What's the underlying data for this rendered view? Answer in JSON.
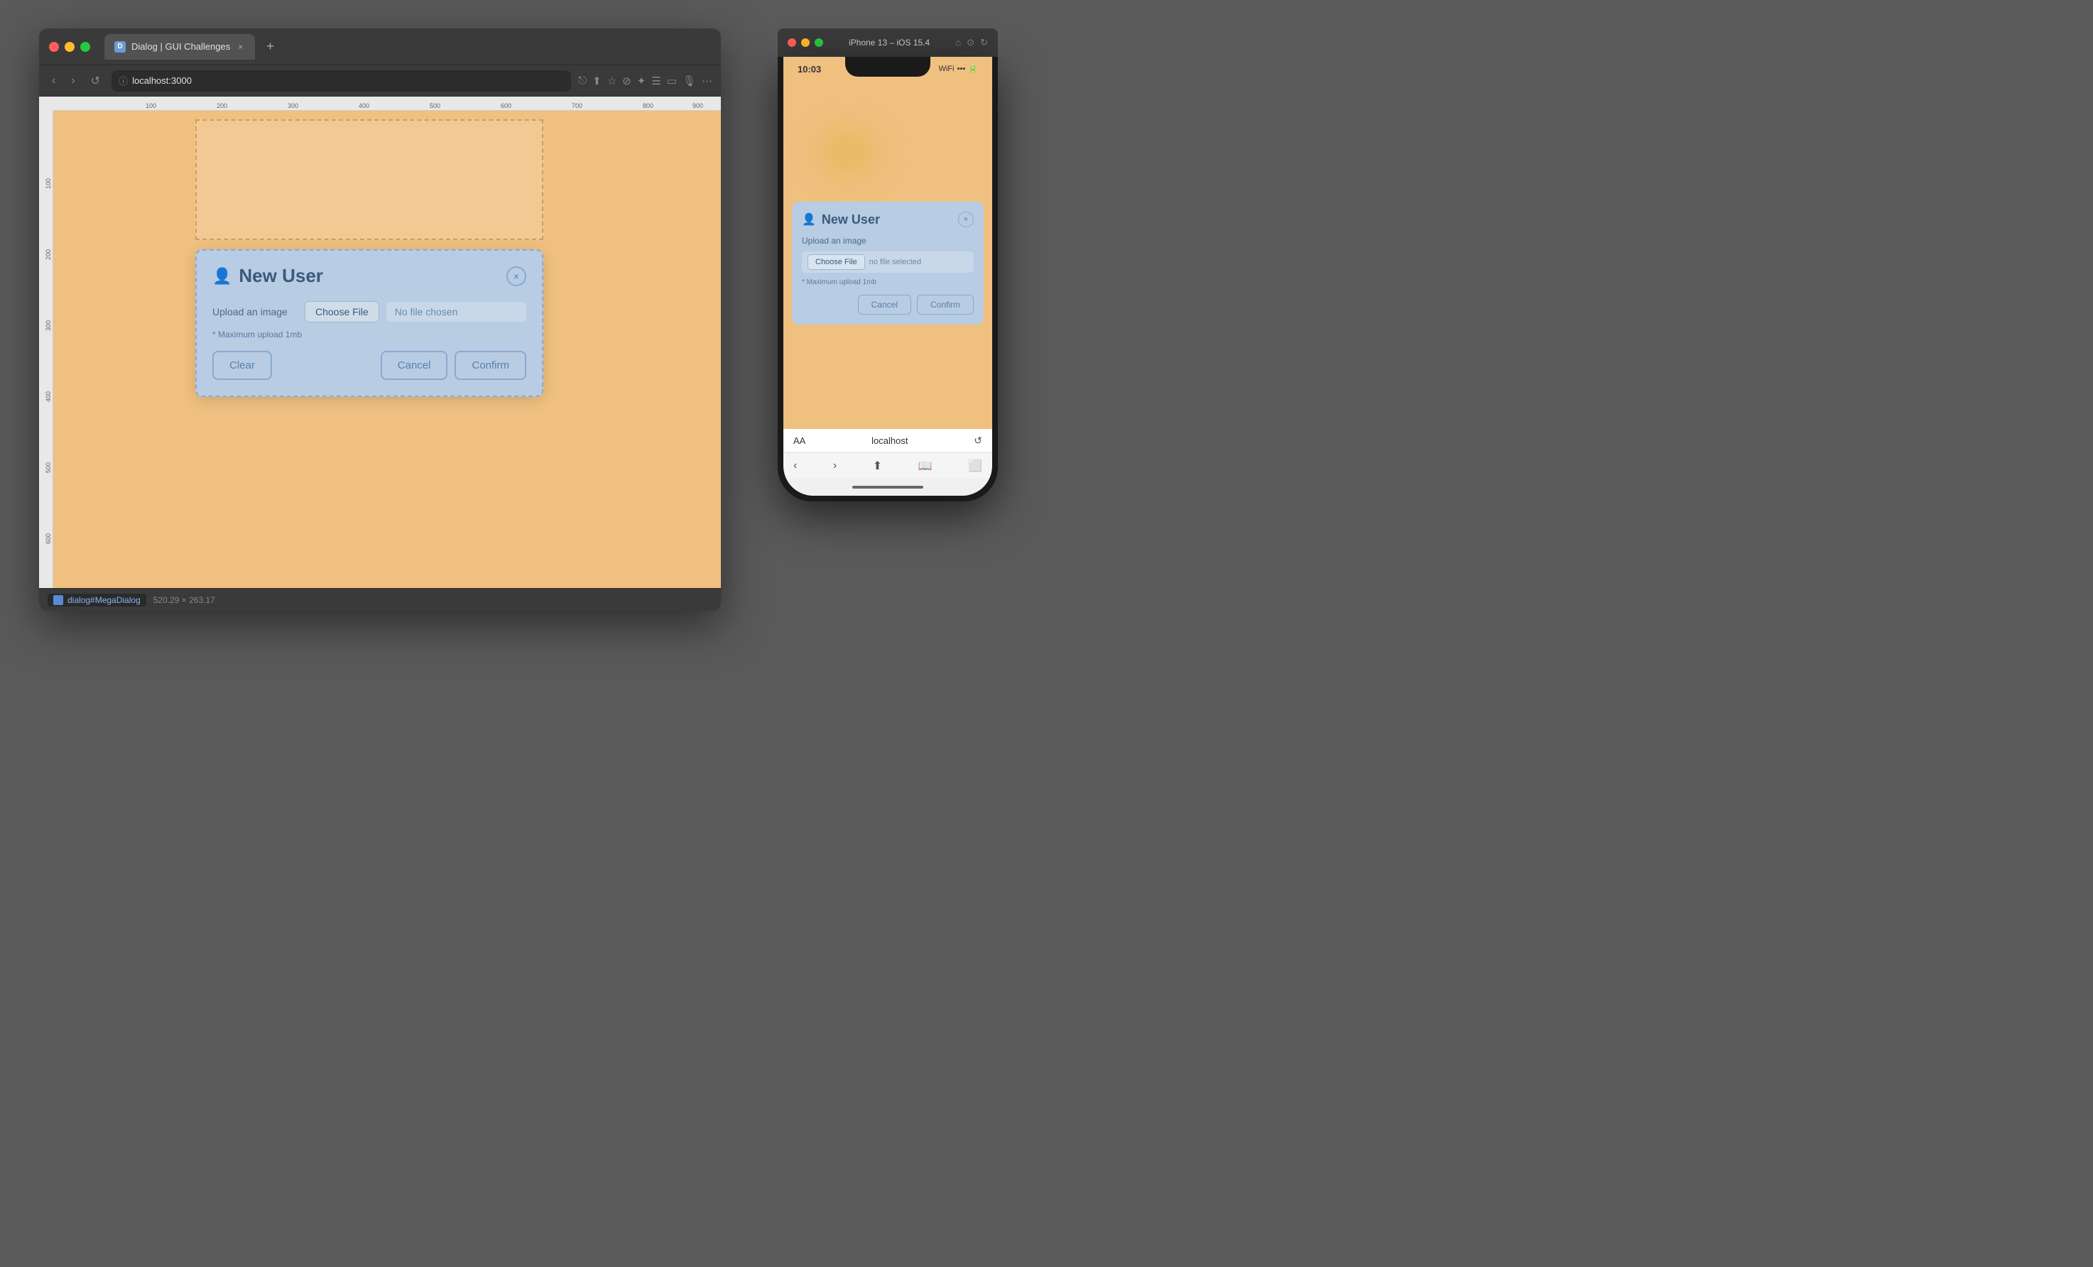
{
  "desktop": {
    "bg_color": "#5a5a5a"
  },
  "browser": {
    "tab_label": "Dialog | GUI Challenges",
    "address": "localhost:3000",
    "traffic_lights": [
      "red",
      "yellow",
      "green"
    ]
  },
  "dialog": {
    "title": "New User",
    "upload_label": "Upload an image",
    "choose_file_btn": "Choose File",
    "no_file_label": "No file chosen",
    "hint": "* Maximum upload 1mb",
    "clear_btn": "Clear",
    "cancel_btn": "Cancel",
    "confirm_btn": "Confirm",
    "close_btn": "×"
  },
  "status_bar": {
    "element_label": "dialog#MegaDialog",
    "dimensions": "520.29 × 263.17"
  },
  "phone": {
    "title": "iPhone 13 – iOS 15.4",
    "time": "10:03",
    "dialog": {
      "title": "New User",
      "upload_label": "Upload an image",
      "choose_file_btn": "Choose File",
      "no_file_label": "no file selected",
      "hint": "* Maximum upload 1mb",
      "cancel_btn": "Cancel",
      "confirm_btn": "Confirm",
      "close_btn": "×"
    },
    "browser_url": "localhost",
    "browser_aa": "AA"
  }
}
